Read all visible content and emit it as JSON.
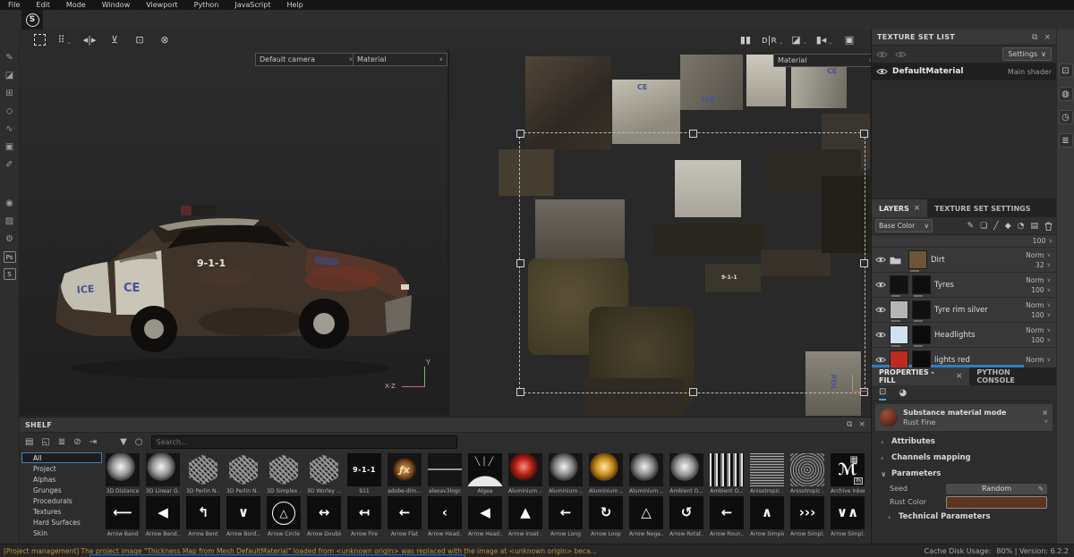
{
  "glyphs": {
    "caret": "∨",
    "chev_closed": "›",
    "chev_open": "∨",
    "float": "⧉",
    "close": "×",
    "filter": "▼"
  },
  "menu": {
    "items": [
      "File",
      "Edit",
      "Mode",
      "Window",
      "Viewport",
      "Python",
      "JavaScript",
      "Help"
    ]
  },
  "logo": {
    "letter": "S"
  },
  "left_toolbar": {
    "tools": [
      {
        "name": "paint-tool-icon",
        "glyph": "✎"
      },
      {
        "name": "eraser-tool-icon",
        "glyph": "◪"
      },
      {
        "name": "projection-tool-icon",
        "glyph": "⊞"
      },
      {
        "name": "polygon-fill-tool-icon",
        "glyph": "◇"
      },
      {
        "name": "smudge-tool-icon",
        "glyph": "∿"
      },
      {
        "name": "clone-tool-icon",
        "glyph": "▣"
      },
      {
        "name": "material-picker-tool-icon",
        "glyph": "✐"
      },
      {
        "name": "tools-divider",
        "glyph": "",
        "mod": "gap"
      },
      {
        "name": "display-settings-icon",
        "glyph": "◉"
      },
      {
        "name": "viewer-settings-icon",
        "glyph": "▨"
      },
      {
        "name": "camera-settings-icon",
        "glyph": "⚙"
      },
      {
        "name": "photoshop-badge-icon",
        "glyph": "Ps",
        "mod": "badge"
      },
      {
        "name": "substance-share-icon",
        "glyph": "S",
        "mod": "badge"
      }
    ]
  },
  "top_toolbar": {
    "left_icons": [
      {
        "name": "selection-frame-icon",
        "glyph": "",
        "mod": "dashedbox"
      },
      {
        "name": "quick-mask-icon",
        "glyph": "⠿",
        "caret": "⌄"
      },
      {
        "name": "symmetry-icon",
        "glyph": "◂|▸"
      },
      {
        "name": "align-mirror-icon",
        "glyph": "⊻"
      },
      {
        "name": "focus-frame-icon",
        "glyph": "⊡"
      },
      {
        "name": "discard-stroke-icon",
        "glyph": "⊗"
      }
    ],
    "right_icons": [
      {
        "name": "pause-engine-icon",
        "glyph": "▮▮"
      },
      {
        "name": "render-state-icon",
        "glyph": "ᴅ|ʀ",
        "caret": "⌄"
      },
      {
        "name": "geometry-mask-icon",
        "glyph": "◪",
        "caret": "⌄"
      },
      {
        "name": "camera-mode-icon",
        "glyph": "▮◂",
        "caret": "⌄"
      },
      {
        "name": "screenshot-icon",
        "glyph": "▣"
      }
    ]
  },
  "viewport3d": {
    "camera_select": "Default camera",
    "shading_select": "Material",
    "axis_y": "Y",
    "axis_xz": "X-Z",
    "car_labels": {
      "rear_quarter": "ICE",
      "door": "CE",
      "side": "9-1-1"
    }
  },
  "viewport2d": {
    "shading_select": "Material",
    "labels": {
      "l1": "CE",
      "l2": "ICE",
      "l3": "CE",
      "l4": "9-1-1",
      "l5": "POL"
    }
  },
  "texture_set_list": {
    "title": "TEXTURE SET LIST",
    "settings_label": "Settings",
    "material": {
      "name": "DefaultMaterial",
      "shader": "Main shader"
    }
  },
  "layers_panel": {
    "tab_layers": "LAYERS",
    "tab_texture_set_settings": "TEXTURE SET SETTINGS",
    "channel_select": "Base Color",
    "toolbar_icons": [
      {
        "name": "add-effect-icon",
        "glyph": "✎"
      },
      {
        "name": "add-fill-layer-icon",
        "glyph": "❏"
      },
      {
        "name": "add-paint-layer-icon",
        "glyph": "╱"
      },
      {
        "name": "add-smart-material-icon",
        "glyph": "◆"
      },
      {
        "name": "add-adjustment-icon",
        "glyph": "◔"
      },
      {
        "name": "add-folder-icon",
        "glyph": "▤"
      }
    ],
    "partial_opacity": "100",
    "layers": [
      {
        "name": "Dirt",
        "blend": "Norm",
        "opacity": "32",
        "folder": true,
        "thumb": "#6d5637"
      },
      {
        "name": "Tyres",
        "blend": "Norm",
        "opacity": "100",
        "thumb": "#141210",
        "mask": "#0e0e0e"
      },
      {
        "name": "Tyre rim silver",
        "blend": "Norm",
        "opacity": "100",
        "thumb": "#b5b5b3",
        "mask": "#101010"
      },
      {
        "name": "Headlights",
        "blend": "Norm",
        "opacity": "100",
        "thumb": "#cfe2ee",
        "mask": "#0b0b0b"
      },
      {
        "name": "lights red",
        "blend": "Norm",
        "thumb": "#bf2a20",
        "mask": "#0b0b0b"
      }
    ]
  },
  "properties": {
    "tab_fill": "PROPERTIES - FILL",
    "tab_python": "PYTHON CONSOLE",
    "material_mode": {
      "title": "Substance material mode",
      "value": "Rust Fine"
    },
    "sections": {
      "attributes": "Attributes",
      "channels": "Channels mapping",
      "parameters": "Parameters",
      "technical": "Technical Parameters"
    },
    "seed_label": "Seed",
    "seed_value": "Random",
    "rust_color_label": "Rust Color",
    "rust_color": "#5c3520"
  },
  "right_strip": {
    "icons": [
      {
        "name": "display-settings-panel-icon",
        "glyph": "⊡"
      },
      {
        "name": "shader-settings-panel-icon",
        "glyph": "◍"
      },
      {
        "name": "history-panel-icon",
        "glyph": "◷"
      },
      {
        "name": "log-panel-icon",
        "glyph": "≣"
      }
    ]
  },
  "shelf": {
    "title": "SHELF",
    "search_placeholder": "Search...",
    "toolbar_icons": [
      {
        "name": "shelf-folder-icon",
        "glyph": "▤"
      },
      {
        "name": "shelf-new-icon",
        "glyph": "◱"
      },
      {
        "name": "shelf-doc-icon",
        "glyph": "≣"
      },
      {
        "name": "shelf-hide-icon",
        "glyph": "⊘"
      },
      {
        "name": "shelf-import-icon",
        "glyph": "⇥"
      },
      {
        "name": "shelf-divider",
        "glyph": "",
        "mod": "gap"
      },
      {
        "name": "filter-icon",
        "glyph": "▼"
      },
      {
        "name": "refresh-icon",
        "glyph": "○"
      }
    ],
    "categories": [
      {
        "label": "All",
        "sel": true
      },
      {
        "label": "Project"
      },
      {
        "label": "Alphas"
      },
      {
        "label": "Grunges"
      },
      {
        "label": "Procedurals"
      },
      {
        "label": "Textures"
      },
      {
        "label": "Hard Surfaces"
      },
      {
        "label": "Skin"
      }
    ],
    "materials": [
      {
        "label": "3D Distance",
        "thumb": "sphere-white"
      },
      {
        "label": "3D Linear G...",
        "thumb": "sphere-white"
      },
      {
        "label": "3D Perlin N...",
        "thumb": "noise-hex"
      },
      {
        "label": "3D Perlin N...",
        "thumb": "noise-hex"
      },
      {
        "label": "3D Simplex ...",
        "thumb": "noise-hex"
      },
      {
        "label": "3D Worley ...",
        "thumb": "noise-hex"
      },
      {
        "label": "911",
        "thumb": "black",
        "glyph": "9-1-1",
        "mod": "sm"
      },
      {
        "label": "adobe-dim...",
        "thumb": "adobe",
        "glyph": "ƒx"
      },
      {
        "label": "alexav3logc",
        "thumb": "line"
      },
      {
        "label": "Algea",
        "thumb": "rays",
        "glyph": "╲│╱",
        "mod": "rays"
      },
      {
        "label": "Aluminium ...",
        "thumb": "sphere-red"
      },
      {
        "label": "Aluminium ...",
        "thumb": "sphere-silver"
      },
      {
        "label": "Aluminium ...",
        "thumb": "sphere-gold"
      },
      {
        "label": "Aluminium ...",
        "thumb": "sphere-silver"
      },
      {
        "label": "Ambient O...",
        "thumb": "sphere-white"
      },
      {
        "label": "Ambient O...",
        "thumb": "noise-bw"
      },
      {
        "label": "Anisotropic ...",
        "thumb": "lines"
      },
      {
        "label": "Anisotropic ...",
        "thumb": "swirl"
      },
      {
        "label": "Archive Inker",
        "thumb": "black",
        "glyph": "ℳ",
        "mod": "script",
        "badge": "Ps"
      }
    ],
    "alphas": [
      {
        "label": "Arrow Band",
        "thumb": "black",
        "glyph": "⟵"
      },
      {
        "label": "Arrow Bend...",
        "thumb": "black",
        "glyph": "◀"
      },
      {
        "label": "Arrow Bent",
        "thumb": "black",
        "glyph": "↰"
      },
      {
        "label": "Arrow Bord...",
        "thumb": "black",
        "glyph": "∨"
      },
      {
        "label": "Arrow Circle",
        "thumb": "black",
        "glyph": "△",
        "mod": "circle"
      },
      {
        "label": "Arrow Double",
        "thumb": "black",
        "glyph": "↔"
      },
      {
        "label": "Arrow Fire",
        "thumb": "black",
        "glyph": "↤"
      },
      {
        "label": "Arrow Flat",
        "thumb": "black",
        "glyph": "←"
      },
      {
        "label": "Arrow Head...",
        "thumb": "black",
        "glyph": "‹"
      },
      {
        "label": "Arrow Head...",
        "thumb": "black",
        "glyph": "◀"
      },
      {
        "label": "Arrow Inset ...",
        "thumb": "black",
        "glyph": "▲"
      },
      {
        "label": "Arrow Long",
        "thumb": "black",
        "glyph": "←"
      },
      {
        "label": "Arrow Loop",
        "thumb": "black",
        "glyph": "↻"
      },
      {
        "label": "Arrow Nega...",
        "thumb": "black",
        "glyph": "△"
      },
      {
        "label": "Arrow Rotat...",
        "thumb": "black",
        "glyph": "↺"
      },
      {
        "label": "Arrow Roun...",
        "thumb": "black",
        "glyph": "←"
      },
      {
        "label": "Arrow Simple",
        "thumb": "black",
        "glyph": "∧"
      },
      {
        "label": "Arrow Simpl...",
        "thumb": "black",
        "glyph": "›››"
      },
      {
        "label": "Arrow Simpl...",
        "thumb": "black",
        "glyph": "∨∧"
      }
    ]
  },
  "status_bar": {
    "message": "[Project management] The project image \"Thickness Map from Mesh DefaultMaterial\" loaded from <unknown origin> was replaced with the image at <unknown origin> beca...",
    "cache_label": "Cache Disk Usage:",
    "cache_value": "80% | Version: 6.2.2"
  }
}
